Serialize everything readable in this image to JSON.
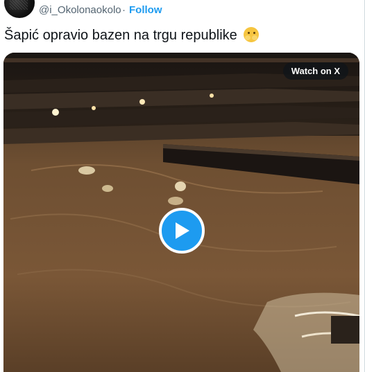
{
  "tweet": {
    "handle": "@i_Okolonaokolo",
    "separator": "·",
    "follow_label": "Follow",
    "text": "Šapić opravio bazen na trgu republike",
    "emoji": "smiling-face-emoji"
  },
  "media": {
    "watch_label": "Watch on X",
    "play_icon": "play-icon",
    "description_icon": "video-thumbnail"
  },
  "colors": {
    "accent": "#1d9bf0",
    "text": "#0f1419",
    "secondary": "#536471"
  }
}
